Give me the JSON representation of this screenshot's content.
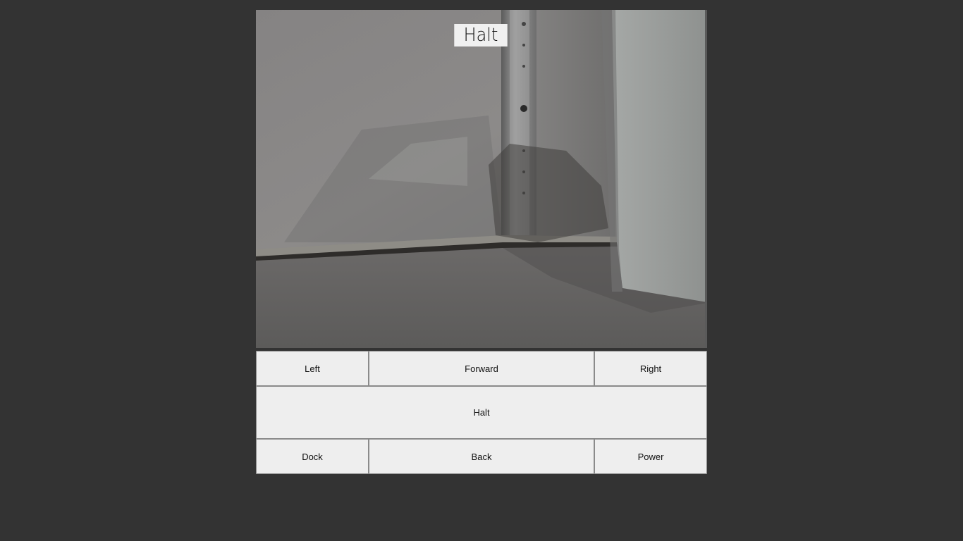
{
  "camera": {
    "overlay_status": "Halt"
  },
  "controls": {
    "left_label": "Left",
    "forward_label": "Forward",
    "right_label": "Right",
    "halt_label": "Halt",
    "dock_label": "Dock",
    "back_label": "Back",
    "power_label": "Power"
  }
}
